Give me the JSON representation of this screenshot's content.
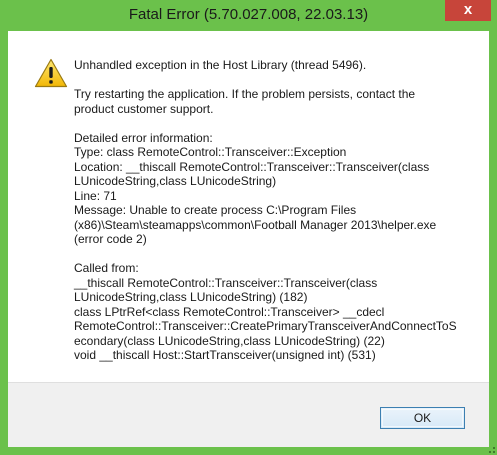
{
  "window": {
    "title": "Fatal Error (5.70.027.008, 22.03.13)",
    "close_glyph": "x",
    "frame_color": "#6bc14b",
    "close_color": "#c7453a"
  },
  "dialog": {
    "icon": "warning-icon",
    "message_lines": [
      "Unhandled exception in the Host Library (thread 5496).",
      "",
      "Try restarting the application. If the problem persists, contact the",
      "product customer support.",
      "",
      "Detailed error information:",
      "Type: class RemoteControl::Transceiver::Exception",
      "Location: __thiscall RemoteControl::Transceiver::Transceiver(class",
      "LUnicodeString,class LUnicodeString)",
      "Line: 71",
      "Message: Unable to create process C:\\Program Files",
      "(x86)\\Steam\\steamapps\\common\\Football Manager 2013\\helper.exe",
      "(error code 2)",
      "",
      "Called from:",
      "__thiscall RemoteControl::Transceiver::Transceiver(class",
      "LUnicodeString,class LUnicodeString) (182)",
      "class LPtrRef<class RemoteControl::Transceiver> __cdecl",
      "RemoteControl::Transceiver::CreatePrimaryTransceiverAndConnectToS",
      "econdary(class LUnicodeString,class LUnicodeString) (22)",
      "void __thiscall Host::StartTransceiver(unsigned int) (531)"
    ],
    "ok_label": "OK"
  }
}
